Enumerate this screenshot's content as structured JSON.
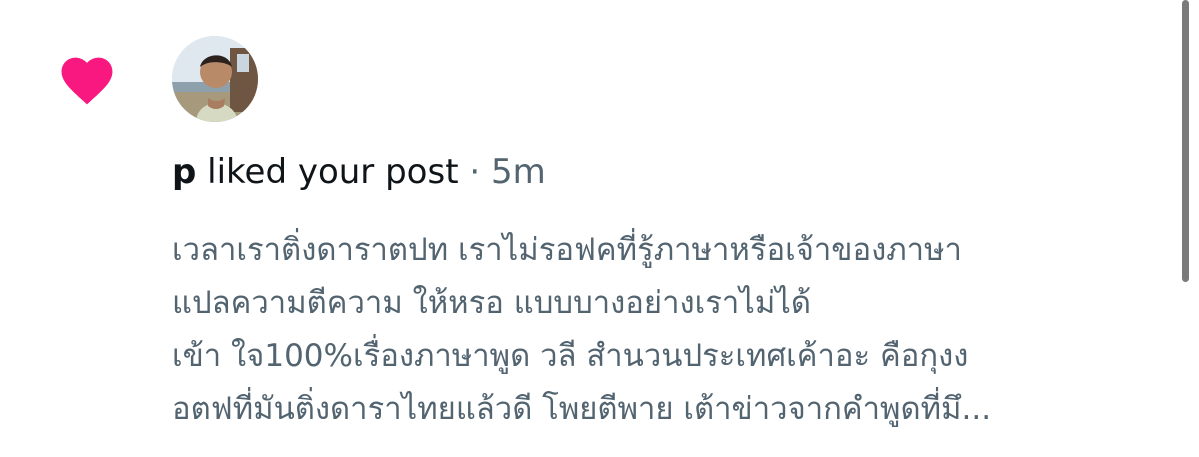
{
  "notification": {
    "type": "like",
    "heart_color": "#f91880",
    "icon": "heart-icon",
    "avatar_icon": "user-avatar",
    "user": "p",
    "action": "liked your post",
    "separator": "·",
    "time": "5m",
    "post_lines": [
      "เวลาเราติ่งดาราตปท เราไม่รอฟคที่รู้ภาษาหรือเจ้าของภาษา",
      "แปลความตีความ ให้หรอ แบบบางอย่างเราไม่ได้",
      "เข้า ใจ100%เรื่องภาษาพูด วลี สำนวนประเทศเค้าอะ คือกุงง",
      "อตฟที่มันติ่งดาราไทยแล้วดี โพยตีพาย เต้าข่าวจากคำพูดที่มึ..."
    ]
  },
  "colors": {
    "primary_text": "#0f1419",
    "secondary_text": "#536471",
    "scrollbar": "#7a7a7a"
  }
}
